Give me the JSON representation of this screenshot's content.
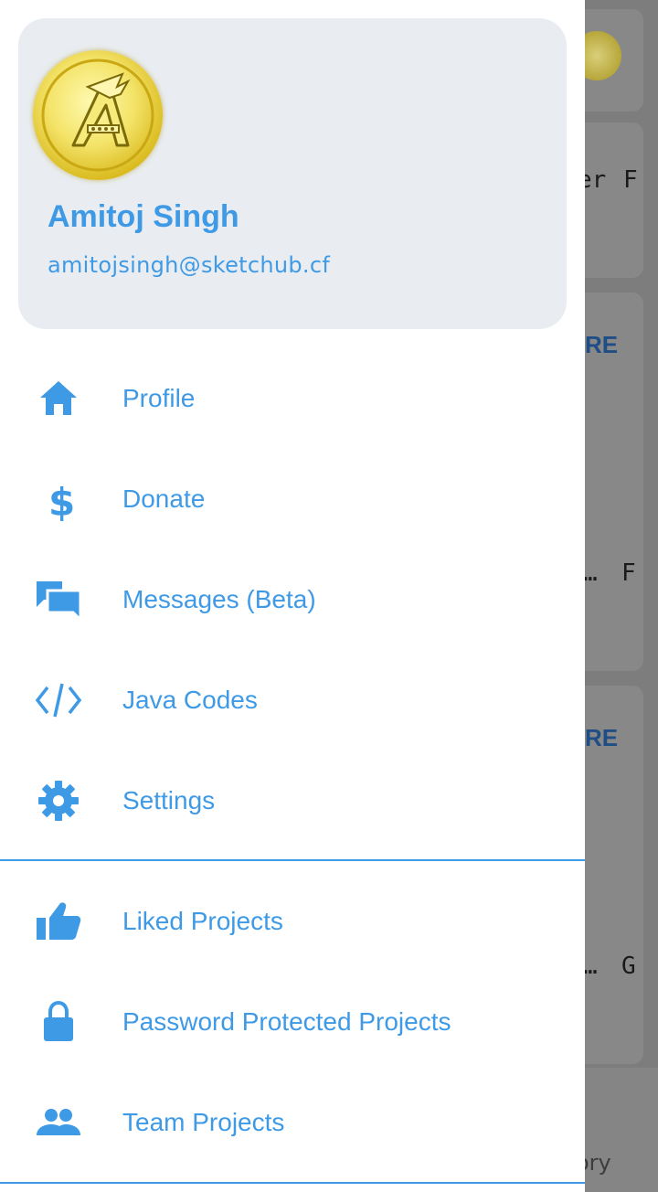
{
  "user": {
    "name": "Amitoj Singh",
    "email": "amitojsingh@sketchub.cf"
  },
  "menu_primary": [
    {
      "label": "Profile",
      "icon": "home-icon"
    },
    {
      "label": "Donate",
      "icon": "dollar-icon"
    },
    {
      "label": "Messages (Beta)",
      "icon": "chat-icon"
    },
    {
      "label": "Java Codes",
      "icon": "code-icon"
    },
    {
      "label": "Settings",
      "icon": "gear-icon"
    }
  ],
  "menu_secondary": [
    {
      "label": "Liked Projects",
      "icon": "thumb-up-icon"
    },
    {
      "label": "Password Protected Projects",
      "icon": "lock-icon"
    },
    {
      "label": "Team Projects",
      "icon": "people-icon"
    }
  ],
  "background": {
    "card1_text": "er",
    "card1_letter": "F",
    "card2_badge": "RE",
    "card2_text": "…",
    "card2_letter": "F",
    "card3_badge": "RE",
    "card3_text": "…",
    "card3_letter": "G",
    "bottom_text": "ory"
  },
  "colors": {
    "accent": "#3f9ae6",
    "header_bg": "#e9edf1",
    "scrim": "#7d7d7d"
  }
}
